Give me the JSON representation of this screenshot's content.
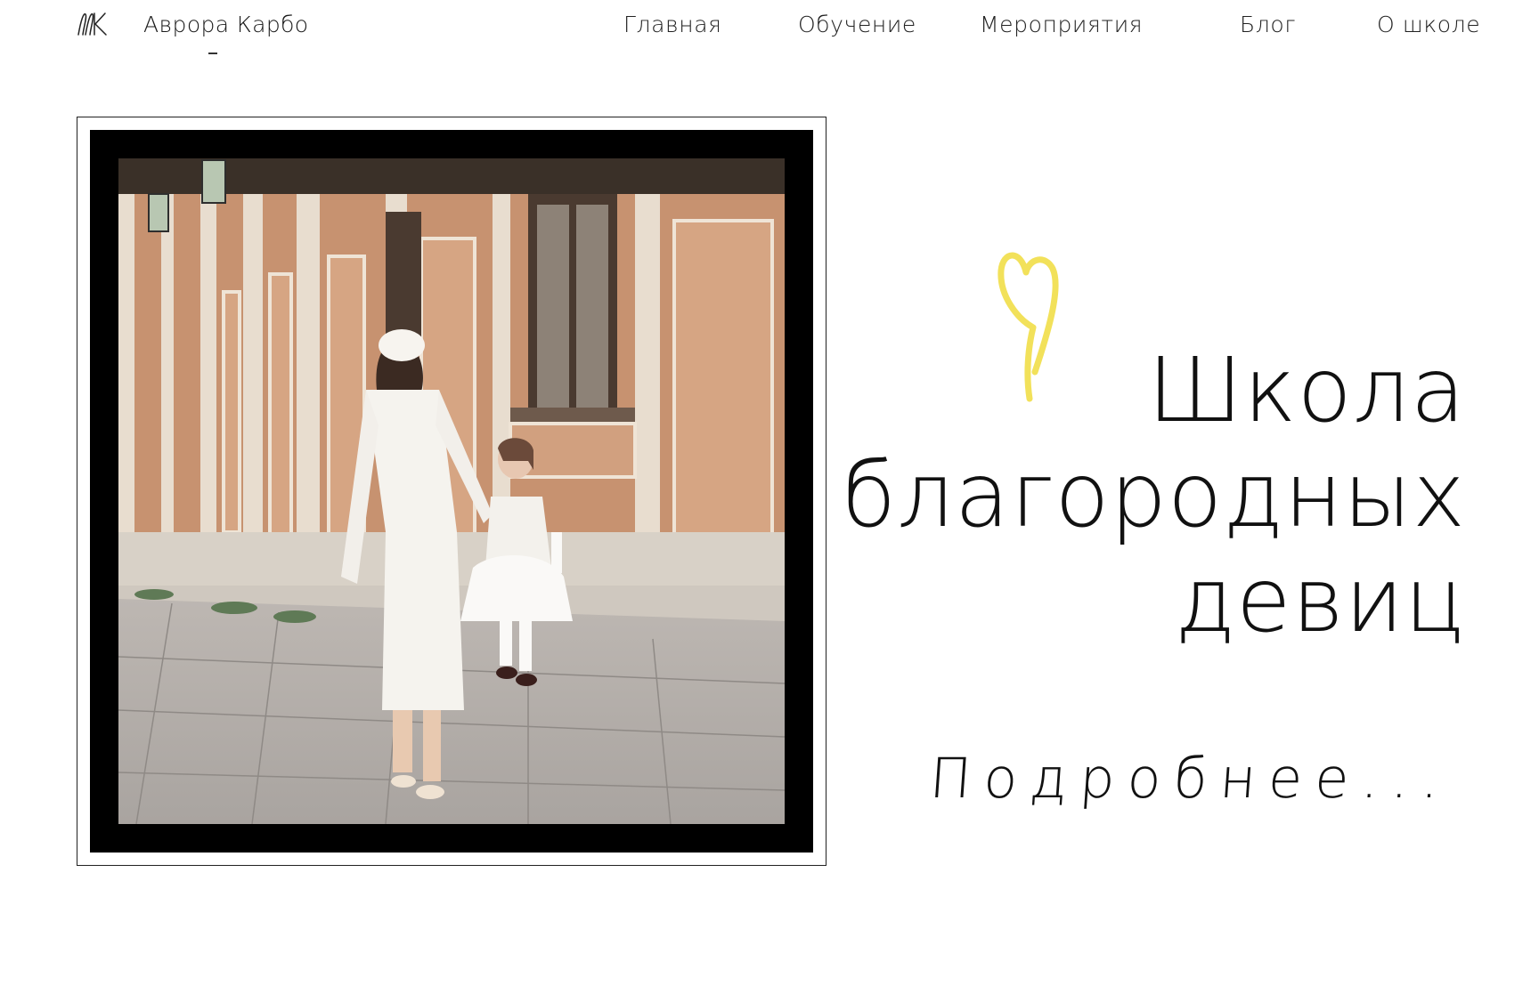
{
  "brand": {
    "name": "Аврора Карбо",
    "logo_icon": "ak-monogram-icon"
  },
  "nav": {
    "items": [
      {
        "id": "home",
        "label": "Главная"
      },
      {
        "id": "learning",
        "label": "Обучение"
      },
      {
        "id": "events",
        "label": "Мероприятия"
      },
      {
        "id": "blog",
        "label": "Блог"
      },
      {
        "id": "about",
        "label": "О школе"
      }
    ]
  },
  "hero": {
    "title_lines": [
      "Школа",
      "благородных",
      "девиц"
    ],
    "more_label": "Подробнее...",
    "heart_color": "#f2e15a",
    "photo_icon": "mother-daughter-photo"
  }
}
